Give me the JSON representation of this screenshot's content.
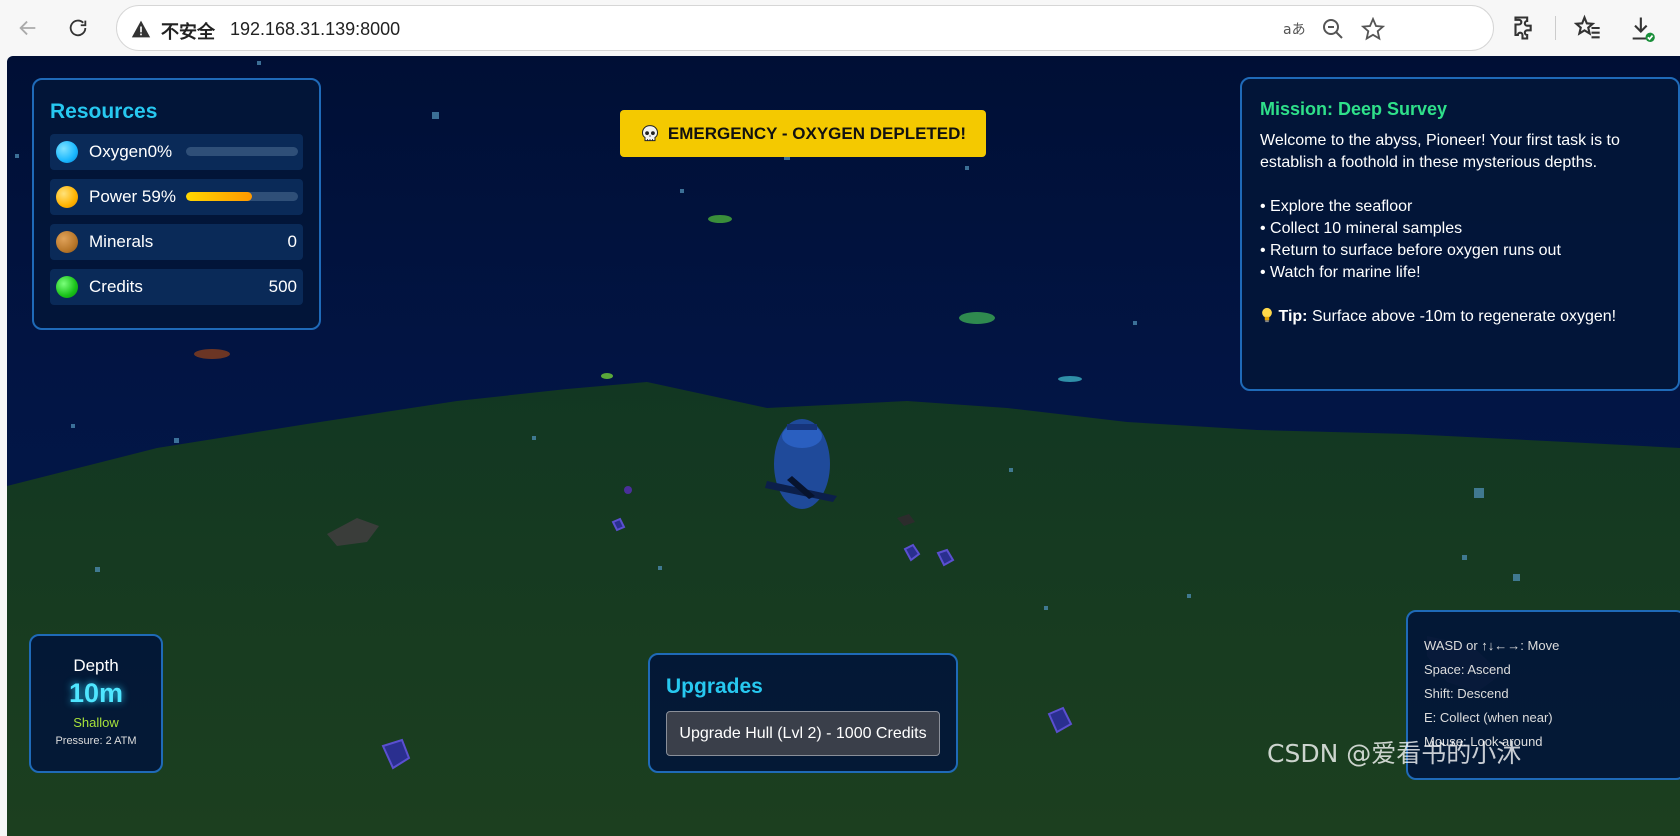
{
  "browser": {
    "security_label": "不安全",
    "url": "192.168.31.139:8000"
  },
  "resources": {
    "title": "Resources",
    "items": [
      {
        "label": "Oxygen0%",
        "level": 0,
        "color": "#1ab8ff",
        "type": "bar"
      },
      {
        "label": "Power 59%",
        "level": 59,
        "color": "#ffb300",
        "type": "bar"
      },
      {
        "label": "Minerals",
        "value": "0",
        "color": "#b8772a",
        "type": "value"
      },
      {
        "label": "Credits",
        "value": "500",
        "color": "#19c219",
        "type": "value"
      }
    ]
  },
  "alert": {
    "icon": "skull-icon",
    "text": "EMERGENCY - OXYGEN DEPLETED!"
  },
  "mission": {
    "title": "Mission: Deep Survey",
    "intro": "Welcome to the abyss, Pioneer! Your first task is to establish a foothold in these mysterious depths.",
    "objectives": [
      "• Explore the seafloor",
      "• Collect 10 mineral samples",
      "• Return to surface before oxygen runs out",
      "• Watch for marine life!"
    ],
    "tip_label": "Tip:",
    "tip_text": "Surface above -10m to regenerate oxygen!"
  },
  "depth": {
    "label": "Depth",
    "value": "10m",
    "zone": "Shallow",
    "pressure": "Pressure: 2 ATM"
  },
  "upgrades": {
    "title": "Upgrades",
    "button": "Upgrade Hull (Lvl 2) - 1000 Credits"
  },
  "controls": [
    "WASD or ↑↓←→: Move",
    "Space: Ascend",
    "Shift: Descend",
    "E: Collect (when near)",
    "Mouse: Look around"
  ],
  "watermark": "CSDN @爱看书的小沐"
}
